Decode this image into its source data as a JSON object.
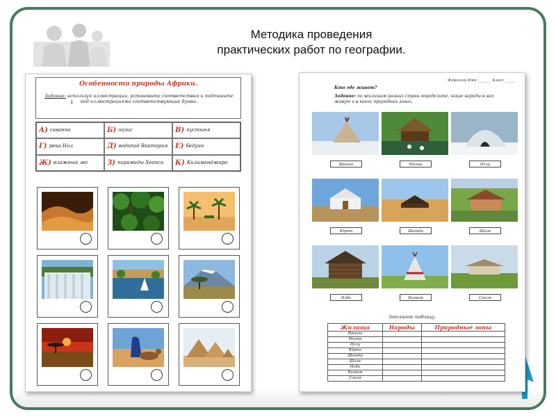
{
  "slide": {
    "title_line1": "Методика проведения",
    "title_line2": "практических работ по географии."
  },
  "worksheet1": {
    "title": "Особенности природы Африки.",
    "task_lead": "Задание:",
    "task_text": " используя иллюстрации, установите соответствия и подпишите под иллюстрациями соответствующие буквы.",
    "cursor_mark": "I",
    "options": [
      {
        "letter": "А)",
        "text": "саванна"
      },
      {
        "letter": "Б)",
        "text": "оазис"
      },
      {
        "letter": "В)",
        "text": "пустыня"
      },
      {
        "letter": "Г)",
        "text": "река Нил"
      },
      {
        "letter": "Д)",
        "text": "водопад Виктория"
      },
      {
        "letter": "Е)",
        "text": "бедуин"
      },
      {
        "letter": "Ж)",
        "text": "влажный лес"
      },
      {
        "letter": "З)",
        "text": "пирамиды Хеопса"
      },
      {
        "letter": "К)",
        "text": "Килиманджаро"
      }
    ],
    "photos": [
      "desert-dunes",
      "rainforest",
      "oasis-palms",
      "victoria-falls",
      "river-nile",
      "kilimanjaro",
      "savanna-sunset",
      "bedouin-camel",
      "pyramids"
    ]
  },
  "worksheet2": {
    "name_line": "Фамилия Имя _______ Класс _____",
    "question": "Кто где живет?",
    "task_lead": "Задание:",
    "task_text": " по жилищам разных стран определите, какие народы в них живут и в каких природных зонах.",
    "dwellings": [
      "Яранга",
      "Минка",
      "Иглу",
      "Юрта",
      "Шатёр",
      "Шале",
      "Изба",
      "Вигвам",
      "Сакля"
    ],
    "fill_table": "Заполните таблицу.",
    "table_headers": [
      "Жилища",
      "Народы",
      "Природные зоны"
    ],
    "table_rows": [
      "Яранга",
      "Минка",
      "Иглу",
      "Юрта",
      "Шатёр",
      "Шале",
      "Изба",
      "Вигвам",
      "Сакля"
    ]
  },
  "colors": {
    "frame": "#4a7a5f",
    "accent_red": "#c0392b",
    "arrow": "#1f9bc7"
  }
}
